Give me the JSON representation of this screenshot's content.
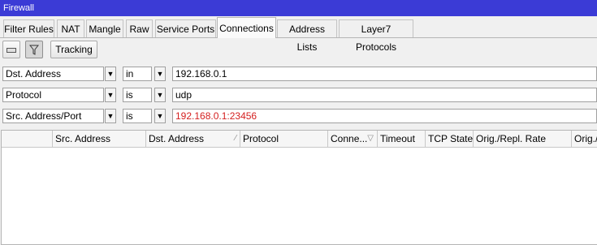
{
  "window": {
    "title": "Firewall"
  },
  "tabs": [
    {
      "label": "Filter Rules"
    },
    {
      "label": "NAT"
    },
    {
      "label": "Mangle"
    },
    {
      "label": "Raw"
    },
    {
      "label": "Service Ports"
    },
    {
      "label": "Connections"
    },
    {
      "label": "Address Lists"
    },
    {
      "label": "Layer7 Protocols"
    }
  ],
  "active_tab": "Connections",
  "toolbar": {
    "remove_icon": "minus-icon",
    "filter_icon": "filter-icon",
    "tracking_label": "Tracking"
  },
  "filters": [
    {
      "field": "Dst. Address",
      "operator": "in",
      "value": "192.168.0.1",
      "value_color": "#000000"
    },
    {
      "field": "Protocol",
      "operator": "is",
      "value": "udp",
      "value_color": "#000000"
    },
    {
      "field": "Src. Address/Port",
      "operator": "is",
      "value": "192.168.0.1:23456",
      "value_color": "#d42020"
    }
  ],
  "dropdown_icon": "chevron-down-icon",
  "table": {
    "columns": [
      {
        "label": ""
      },
      {
        "label": "Src. Address"
      },
      {
        "label": "Dst. Address"
      },
      {
        "label": "Protocol"
      },
      {
        "label": "Conne..."
      },
      {
        "label": "Timeout"
      },
      {
        "label": "TCP State"
      },
      {
        "label": "Orig./Repl. Rate"
      },
      {
        "label": "Orig./R"
      }
    ],
    "rows": []
  }
}
